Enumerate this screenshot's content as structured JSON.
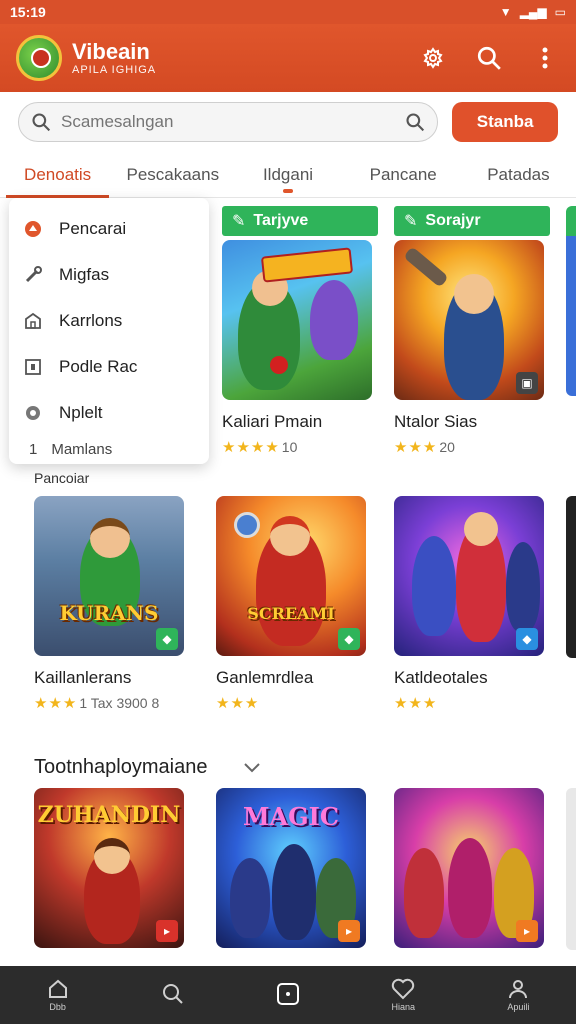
{
  "status": {
    "time": "15:19"
  },
  "app": {
    "title": "Vibeain",
    "subtitle": "APILA IGHIGA"
  },
  "search": {
    "placeholder": "Scamesalngan",
    "button_label": "Stanba"
  },
  "tabs": [
    {
      "label": "Denoatis"
    },
    {
      "label": "Pescakaans"
    },
    {
      "label": "Ildgani"
    },
    {
      "label": "Pancane"
    },
    {
      "label": "Patadas"
    }
  ],
  "dropdown": {
    "items": [
      {
        "label": "Pencarai",
        "icon": "alert-circle-icon"
      },
      {
        "label": "Migfas",
        "icon": "wrench-icon"
      },
      {
        "label": "Karrlons",
        "icon": "store-icon"
      },
      {
        "label": "Podle Rac",
        "icon": "square-icon"
      },
      {
        "label": "Nplelt",
        "icon": "pin-icon"
      }
    ],
    "sub_item": {
      "prefix": "1",
      "label": "Mamlans"
    }
  },
  "row1": [
    {
      "badge": "Tarjyve",
      "name": "Kaliari Pmain",
      "stars": "★★★★",
      "rating": "10"
    },
    {
      "badge": "Sorajyr",
      "name": "Ntalor Sias",
      "stars": "★★★",
      "rating": "20"
    }
  ],
  "section1": {
    "label": "Pancoiar"
  },
  "row2": [
    {
      "name": "Kaillanlerans",
      "stars": "★★★",
      "rating": "1  Tax 3900  8",
      "banner": "KURANS"
    },
    {
      "name": "Ganlemrdlea",
      "stars": "★★★",
      "rating": "",
      "banner": "SCREAMI"
    },
    {
      "name": "Katldeotales",
      "stars": "★★★",
      "rating": "",
      "banner": ""
    }
  ],
  "section2": {
    "label": "Tootnhaploymaiane"
  },
  "row3": [
    {
      "banner": "ZUHANDIN"
    },
    {
      "banner": "MAGIC"
    },
    {
      "banner": ""
    }
  ],
  "nav": [
    {
      "label": "Dbb",
      "icon": "home-icon"
    },
    {
      "label": "",
      "icon": "search-icon"
    },
    {
      "label": "",
      "icon": "square-icon"
    },
    {
      "label": "Hiana",
      "icon": "heart-icon"
    },
    {
      "label": "Apuili",
      "icon": "profile-icon"
    }
  ],
  "colors": {
    "accent": "#e0562c",
    "badge": "#2fb45a",
    "nav_bg": "#2c2c2c"
  }
}
